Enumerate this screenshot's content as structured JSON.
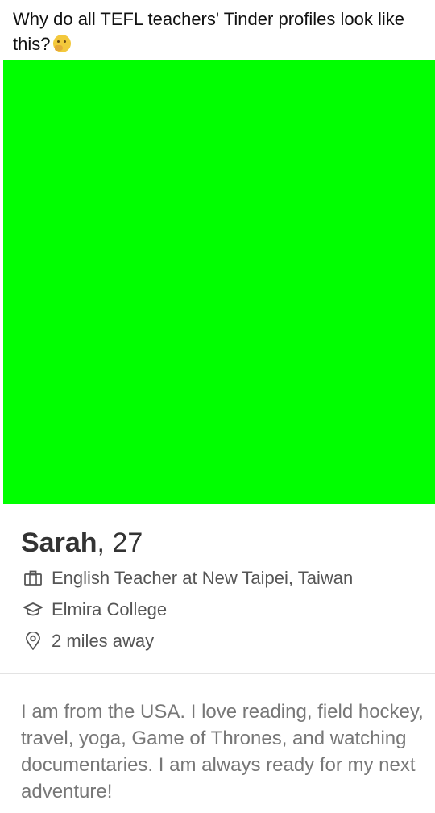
{
  "post": {
    "text": "Why do all TEFL teachers' Tinder profiles look like this?",
    "emoji_icon": "thinking-face-emoji"
  },
  "photo": {
    "fill_color": "#00ff00"
  },
  "profile": {
    "name": "Sarah",
    "separator": ", ",
    "age": "27",
    "job": "English Teacher at New Taipei, Taiwan",
    "job_icon": "briefcase-icon",
    "school": "Elmira College",
    "school_icon": "graduation-cap-icon",
    "distance": "2 miles away",
    "distance_icon": "location-pin-icon",
    "bio": "I am from the USA. I love reading, field hockey, travel, yoga, Game of Thrones, and watching documentaries. I am always ready for my next adventure!"
  }
}
